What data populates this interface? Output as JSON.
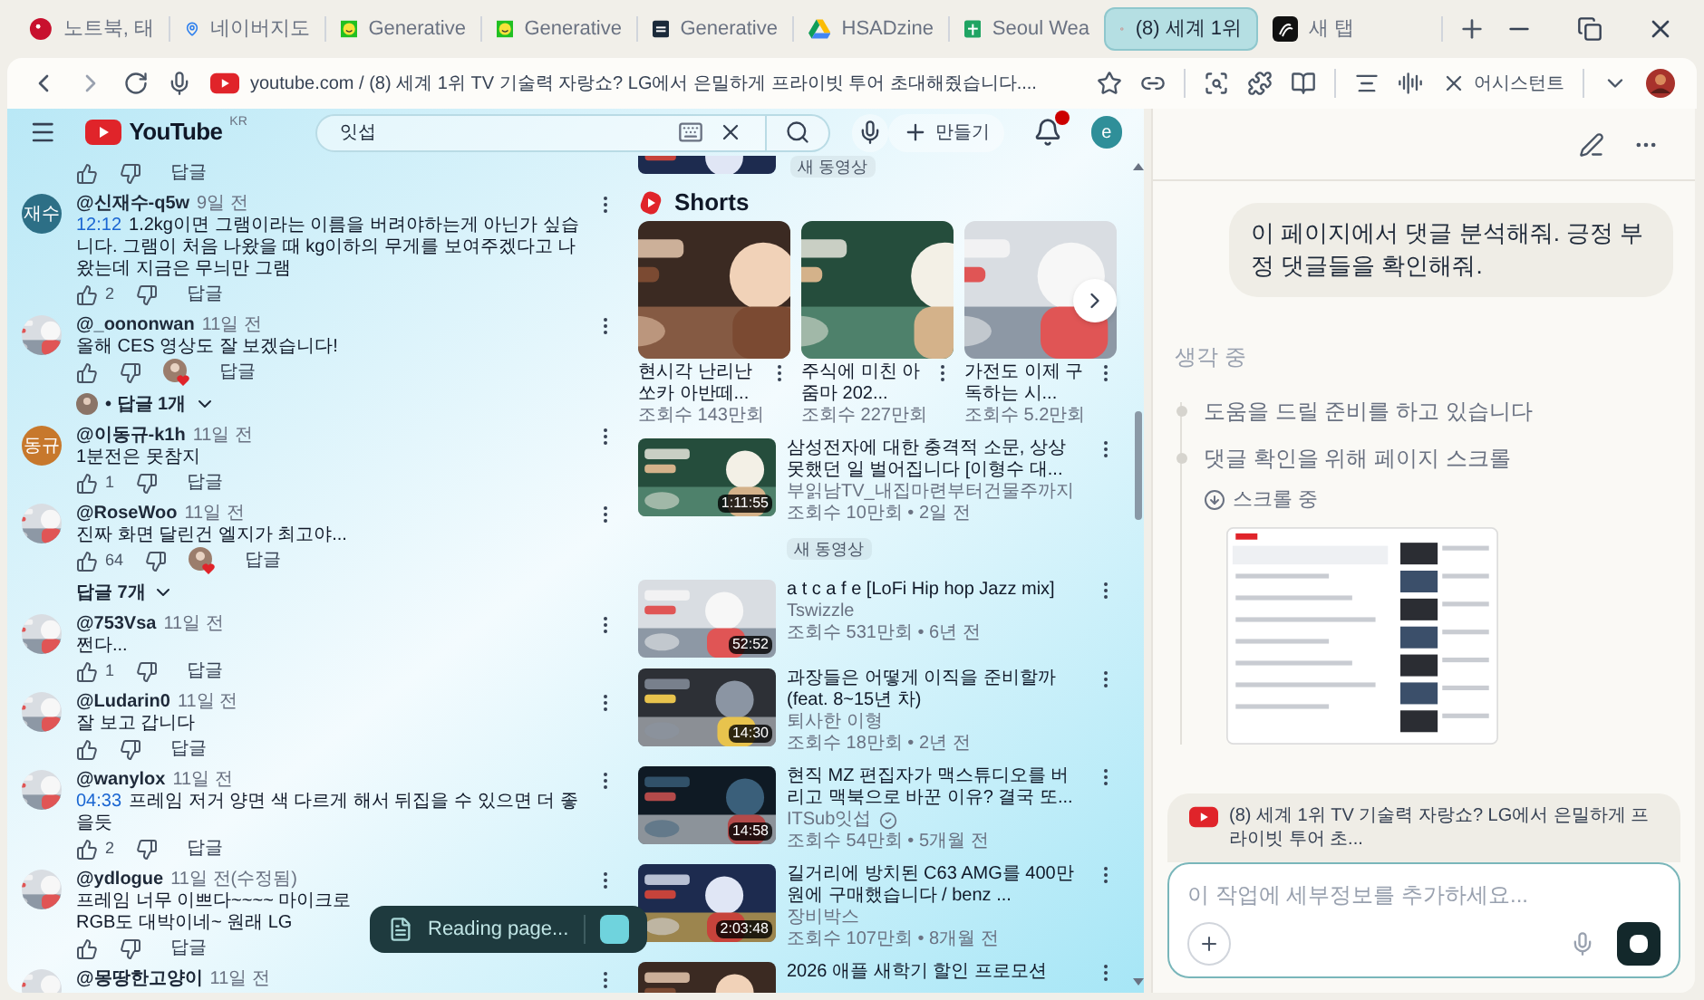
{
  "tabs": [
    {
      "kind": "lg",
      "title": "노트북, 태",
      "selected": false
    },
    {
      "kind": "map",
      "title": "네이버지도",
      "selected": false
    },
    {
      "kind": "smile",
      "title": "Generative",
      "selected": false
    },
    {
      "kind": "smile",
      "title": "Generative",
      "selected": false
    },
    {
      "kind": "sn",
      "title": "Generative",
      "selected": false
    },
    {
      "kind": "drive",
      "title": "HSADzine",
      "selected": false
    },
    {
      "kind": "sheet",
      "title": "Seoul Wea",
      "selected": false
    },
    {
      "kind": "audio",
      "title": "(8) 세계 1위",
      "selected": true
    },
    {
      "kind": "dark",
      "title": "새 탭",
      "selected": false
    }
  ],
  "address": {
    "url": "youtube.com / (8) 세계 1위 TV 기술력 자랑쇼? LG에서 은밀하게 프라이빗 투어 초대해줬습니다....",
    "assistant_button": "어시스턴트"
  },
  "youtube": {
    "logo": "YouTube",
    "region": "KR",
    "search_value": "잇섭",
    "create_button": "만들기",
    "avatar_letter": "e"
  },
  "comments": [
    {
      "kind": "actions",
      "reply": "답글",
      "hearted": false
    },
    {
      "kind": "comment",
      "avatar": {
        "kind": "initials",
        "text": "재수",
        "color": "#2d6f86"
      },
      "author": "@신재수-q5w",
      "time": "9일 전",
      "timestamp": "12:12",
      "text": "1.2kg이면 그램이라는 이름을 버려야하는게 아닌가 싶습니다. 그램이 처음 나왔을 때 kg이하의 무게를 보여주겠다고 나왔는데 지금은 무늬만 그램",
      "likes": "2",
      "reply": "답글",
      "hearted": false
    },
    {
      "kind": "comment",
      "author": "@_oononwan",
      "time": "11일 전",
      "text": "올해 CES 영상도 잘 보겠습니다!",
      "reply": "답글",
      "hearted": true,
      "replies": {
        "label": "• 답글 1개",
        "with_avatar": true
      }
    },
    {
      "kind": "comment",
      "avatar": {
        "kind": "initials",
        "text": "동규",
        "color": "#c7782c"
      },
      "author": "@이동규-k1h",
      "time": "11일 전",
      "text": "1분전은 못참지",
      "likes": "1",
      "reply": "답글",
      "hearted": false
    },
    {
      "kind": "comment",
      "author": "@RoseWoo",
      "time": "11일 전",
      "text": "진짜 화면 달린건 엘지가 최고야...",
      "likes": "64",
      "reply": "답글",
      "hearted": true,
      "replies": {
        "label": "답글 7개",
        "with_avatar": false
      }
    },
    {
      "kind": "comment",
      "author": "@753Vsa",
      "time": "11일 전",
      "text": "쩐다...",
      "likes": "1",
      "reply": "답글",
      "hearted": false
    },
    {
      "kind": "comment",
      "author": "@Ludarin0",
      "time": "11일 전",
      "text": "잘 보고 갑니다",
      "reply": "답글",
      "hearted": false
    },
    {
      "kind": "comment",
      "author": "@wanylox",
      "time": "11일 전",
      "timestamp": "04:33",
      "text": "프레임 저거 양면 색 다르게 해서 뒤집을 수 있으면 더 좋을듯",
      "likes": "2",
      "reply": "답글",
      "hearted": false
    },
    {
      "kind": "comment",
      "author": "@ydlogue",
      "time": "11일 전(수정됨)",
      "text": "프레임 너무 이쁘다~~~~ 마이크로 RGB도 대박이네~ 원래 LG",
      "reply": "답글",
      "hearted": false
    },
    {
      "kind": "header",
      "author": "@몽땅한고양이",
      "time": "11일 전"
    }
  ],
  "toast": {
    "text": "Reading page..."
  },
  "side": {
    "top_badge": "새 동영상",
    "shorts_title": "Shorts",
    "shorts": [
      {
        "title": "현시각 난리난 쏘카 아반떼...",
        "views": "조회수 143만회"
      },
      {
        "title": "주식에 미친 아줌마 202...",
        "views": "조회수 227만회"
      },
      {
        "title": "가전도 이제 구독하는 시...",
        "views": "조회수 5.2만회"
      }
    ],
    "videos": [
      {
        "title": "삼성전자에 대한 충격적 소문, 상상 못했던 일 벌어집니다 [이형수 대...",
        "channel": "부읽남TV_내집마련부터건물주까지",
        "meta": "조회수 10만회 • 2일 전",
        "badge": "새 동영상",
        "duration": "1:11:55",
        "verified": false
      },
      {
        "title": "a t c a f e [LoFi Hip hop Jazz mix]",
        "channel": "Tswizzle",
        "meta": "조회수 531만회 • 6년 전",
        "duration": "52:52",
        "verified": false
      },
      {
        "title": "과장들은 어떻게 이직을 준비할까 (feat. 8~15년 차)",
        "channel": "퇴사한 이형",
        "meta": "조회수 18만회 • 2년 전",
        "duration": "14:30",
        "verified": false
      },
      {
        "title": "현직 MZ 편집자가 맥스튜디오를 버리고 맥북으로 바꾼 이유? 결국 또...",
        "channel": "ITSub잇섭",
        "meta": "조회수 54만회 • 5개월 전",
        "duration": "14:58",
        "verified": true
      },
      {
        "title": "길거리에 방치된 C63 AMG를 400만 원에 구매했습니다 / benz ...",
        "channel": "장비박스",
        "meta": "조회수 107만회 • 8개월 전",
        "duration": "2:03:48",
        "verified": false
      },
      {
        "title": "2026 애플 새학기 할인 프로모션"
      }
    ]
  },
  "assistant": {
    "message": "이 페이지에서 댓글 분석해줘. 긍정 부정 댓글들을 확인해줘.",
    "status": "생각 중",
    "steps": [
      {
        "text": "도움을 드릴 준비를 하고 있습니다"
      },
      {
        "text": "댓글 확인을 위해 페이지 스크롤",
        "substep": "스크롤 중"
      }
    ],
    "context_chip": "(8) 세계 1위 TV 기술력 자랑쇼? LG에서 은밀하게 프라이빗 투어 초...",
    "placeholder": "이 작업에 세부정보를 추가하세요..."
  }
}
